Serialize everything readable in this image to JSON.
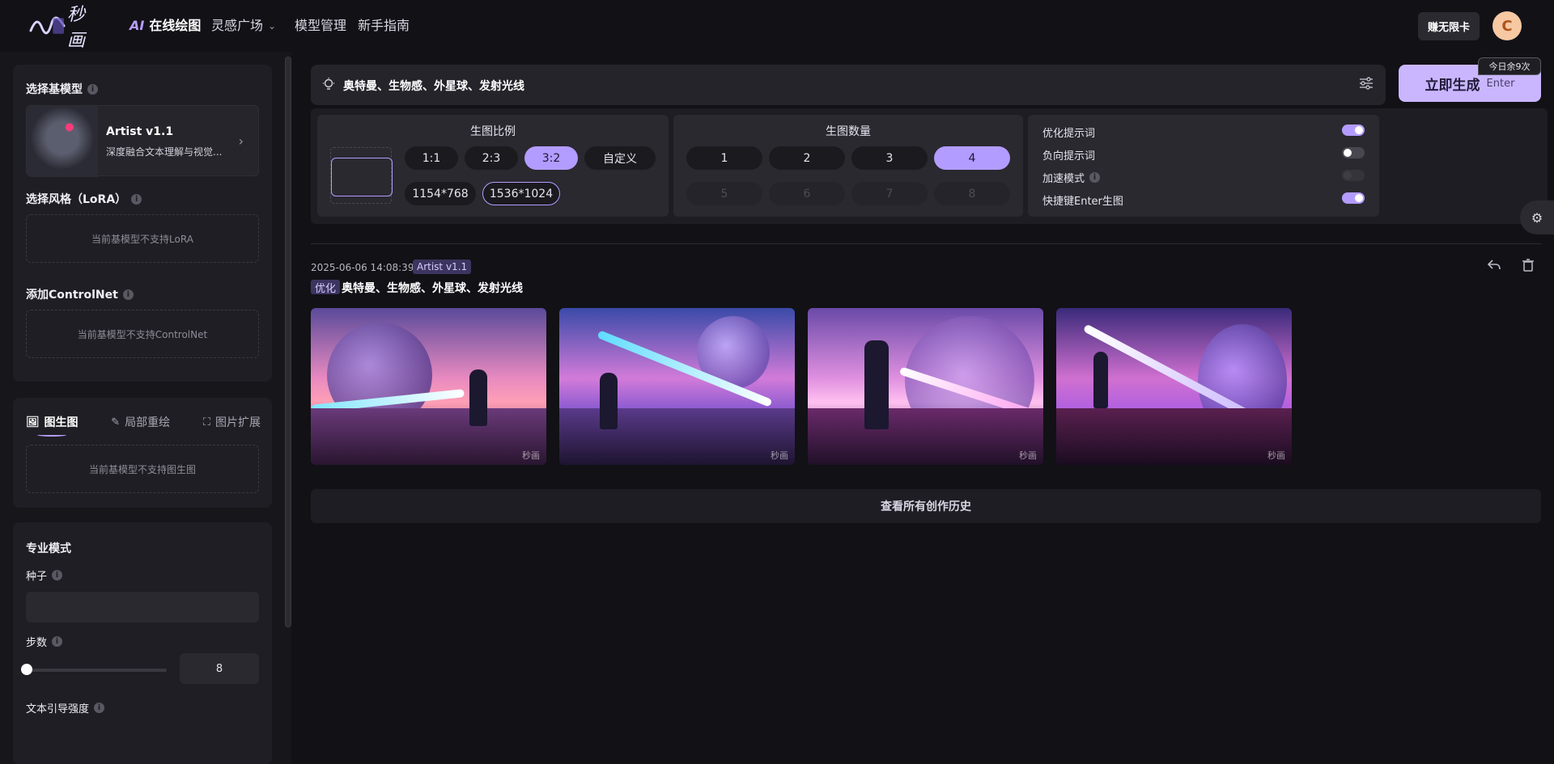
{
  "nav": {
    "logo_text": "秒画",
    "ai_prefix": "AI",
    "items": [
      {
        "label": "在线绘图",
        "active": true
      },
      {
        "label": "灵感广场"
      },
      {
        "label": "模型管理"
      },
      {
        "label": "新手指南"
      }
    ],
    "vip_label": "赚无限卡",
    "avatar_letter": "C"
  },
  "left": {
    "base_model_title": "选择基模型",
    "model_name": "Artist v1.1",
    "model_desc": "深度融合文本理解与视觉...",
    "lora_title": "选择风格（LoRA）",
    "lora_empty": "当前基模型不支持LoRA",
    "controlnet_title": "添加ControlNet",
    "controlnet_empty": "当前基模型不支持ControlNet",
    "tabs": [
      {
        "label": "图生图",
        "icon": "image-icon",
        "active": true
      },
      {
        "label": "局部重绘",
        "icon": "brush-icon"
      },
      {
        "label": "图片扩展",
        "icon": "expand-icon"
      }
    ],
    "img2img_empty": "当前基模型不支持图生图",
    "pro_mode_title": "专业模式",
    "seed_label": "种子",
    "seed_value": "",
    "steps_label": "步数",
    "steps_value": "8",
    "cfg_label": "文本引导强度"
  },
  "prompt": {
    "text": "奥特曼、生物感、外星球、发射光线",
    "generate_label": "立即生成",
    "generate_sub": "Enter",
    "quota": "今日余9次"
  },
  "settings": {
    "ratio_title": "生图比例",
    "ratios": [
      "1:1",
      "2:3",
      "3:2",
      "自定义"
    ],
    "ratio_active": "3:2",
    "sizes": [
      "1154*768",
      "1536*1024"
    ],
    "size_active": "1536*1024",
    "count_title": "生图数量",
    "counts": [
      "1",
      "2",
      "3",
      "4",
      "5",
      "6",
      "7",
      "8"
    ],
    "count_active": "4",
    "toggles": [
      {
        "label": "优化提示词",
        "state": "on"
      },
      {
        "label": "负向提示词",
        "state": "off"
      },
      {
        "label": "加速模式",
        "state": "disabled",
        "info": true
      },
      {
        "label": "快捷键Enter生图",
        "state": "on"
      }
    ]
  },
  "history": {
    "timestamp": "2025-06-06 14:08:39",
    "model_tag": "Artist v1.1",
    "optimized_tag": "优化",
    "prompt": "奥特曼、生物感、外星球、发射光线",
    "watermark": "秒画",
    "view_all_label": "查看所有创作历史"
  },
  "colors": {
    "accent": "#b39cff",
    "background": "#121116",
    "panel": "#1f1e24"
  }
}
